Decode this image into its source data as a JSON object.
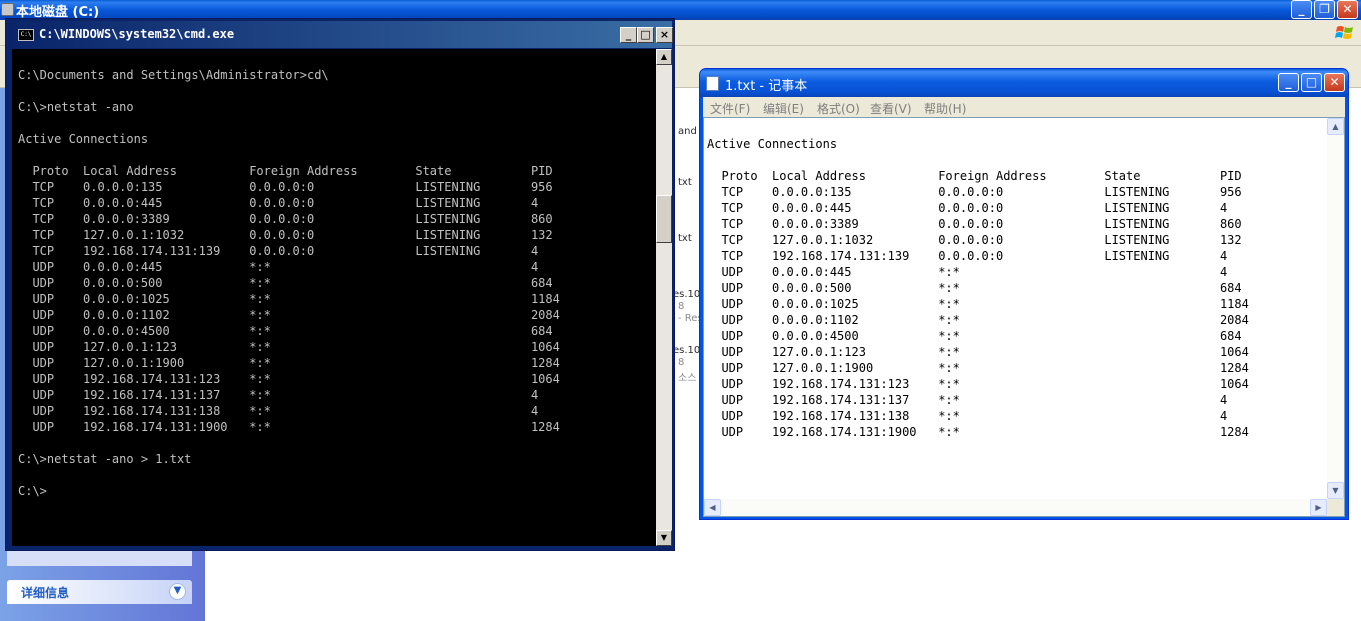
{
  "explorer": {
    "title": "本地磁盘 (C:)",
    "buttons": {
      "minimize": "_",
      "maximize": "❐",
      "close": "✕"
    },
    "details_panel_label": "详细信息",
    "fragments": [
      "and",
      "txt",
      "txt",
      "es.10",
      "8",
      "- Res",
      "es.10",
      "8",
      "소스"
    ]
  },
  "cmd": {
    "title": "C:\\WINDOWS\\system32\\cmd.exe",
    "icon_label": "C:\\",
    "buttons": {
      "minimize": "_",
      "maximize": "□",
      "close": "×"
    },
    "text": "C:\\Documents and Settings\\Administrator>cd\\\n\nC:\\>netstat -ano\n\nActive Connections\n\n  Proto  Local Address          Foreign Address        State           PID\n  TCP    0.0.0.0:135            0.0.0.0:0              LISTENING       956\n  TCP    0.0.0.0:445            0.0.0.0:0              LISTENING       4\n  TCP    0.0.0.0:3389           0.0.0.0:0              LISTENING       860\n  TCP    127.0.0.1:1032         0.0.0.0:0              LISTENING       132\n  TCP    192.168.174.131:139    0.0.0.0:0              LISTENING       4\n  UDP    0.0.0.0:445            *:*                                    4\n  UDP    0.0.0.0:500            *:*                                    684\n  UDP    0.0.0.0:1025           *:*                                    1184\n  UDP    0.0.0.0:1102           *:*                                    2084\n  UDP    0.0.0.0:4500           *:*                                    684\n  UDP    127.0.0.1:123          *:*                                    1064\n  UDP    127.0.0.1:1900         *:*                                    1284\n  UDP    192.168.174.131:123    *:*                                    1064\n  UDP    192.168.174.131:137    *:*                                    4\n  UDP    192.168.174.131:138    *:*                                    4\n  UDP    192.168.174.131:1900   *:*                                    1284\n\nC:\\>netstat -ano > 1.txt\n\nC:\\>"
  },
  "notepad": {
    "title": "1.txt - 记事本",
    "buttons": {
      "minimize": "_",
      "maximize": "□",
      "close": "✕"
    },
    "menu": {
      "file": "文件(F)",
      "edit": "编辑(E)",
      "format": "格式(O)",
      "view": "查看(V)",
      "help": "帮助(H)"
    },
    "text": "Active Connections\n\n  Proto  Local Address          Foreign Address        State           PID\n  TCP    0.0.0.0:135            0.0.0.0:0              LISTENING       956\n  TCP    0.0.0.0:445            0.0.0.0:0              LISTENING       4\n  TCP    0.0.0.0:3389           0.0.0.0:0              LISTENING       860\n  TCP    127.0.0.1:1032         0.0.0.0:0              LISTENING       132\n  TCP    192.168.174.131:139    0.0.0.0:0              LISTENING       4\n  UDP    0.0.0.0:445            *:*                                    4\n  UDP    0.0.0.0:500            *:*                                    684\n  UDP    0.0.0.0:1025           *:*                                    1184\n  UDP    0.0.0.0:1102           *:*                                    2084\n  UDP    0.0.0.0:4500           *:*                                    684\n  UDP    127.0.0.1:123          *:*                                    1064\n  UDP    127.0.0.1:1900         *:*                                    1284\n  UDP    192.168.174.131:123    *:*                                    1064\n  UDP    192.168.174.131:137    *:*                                    4\n  UDP    192.168.174.131:138    *:*                                    4\n  UDP    192.168.174.131:1900   *:*                                    1284"
  },
  "colors": {
    "xp_blue": "#0055e5",
    "console_bg": "#000000",
    "console_fg": "#c0c0c0",
    "classic_title": "#0a246a"
  }
}
